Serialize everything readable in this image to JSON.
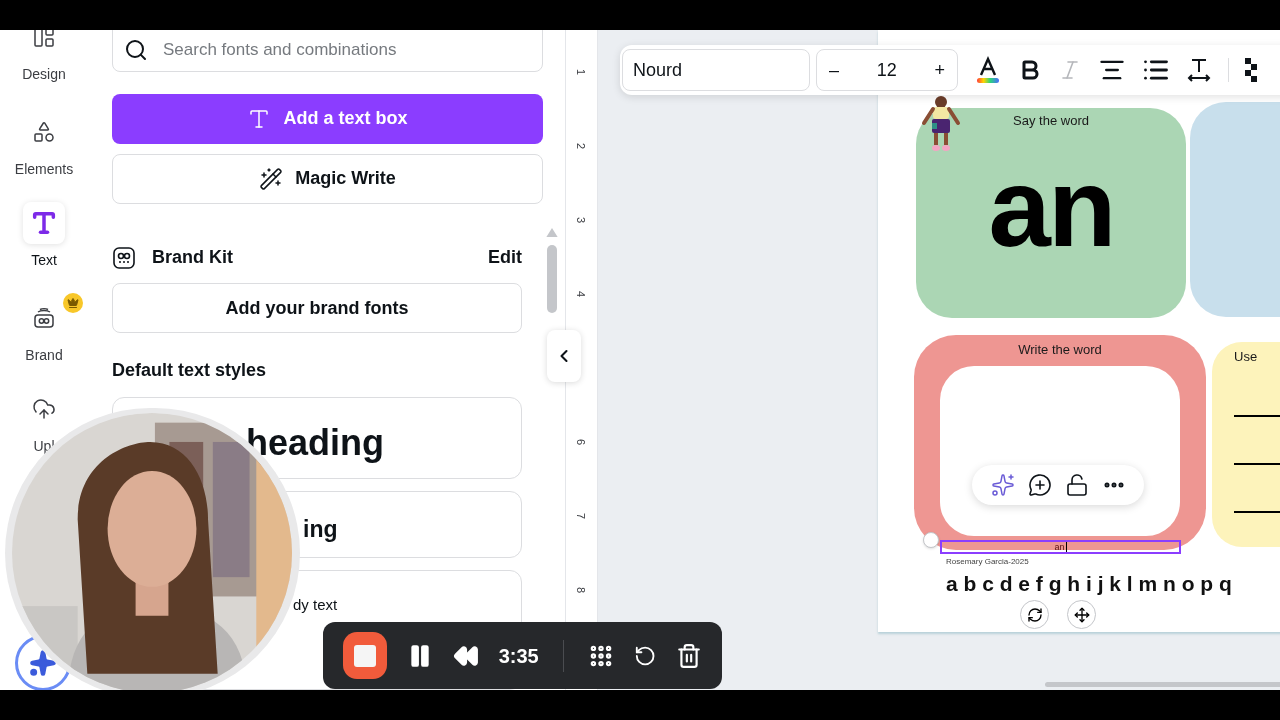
{
  "sidebar": {
    "items": [
      {
        "kind": "design",
        "label": "Design",
        "selected": false,
        "premium": false
      },
      {
        "kind": "elements",
        "label": "Elements",
        "selected": false,
        "premium": false
      },
      {
        "kind": "text",
        "label": "Text",
        "selected": true,
        "premium": false
      },
      {
        "kind": "brand",
        "label": "Brand",
        "selected": false,
        "premium": true
      },
      {
        "kind": "uploads",
        "label": "Upl",
        "selected": false,
        "premium": false
      }
    ]
  },
  "panel": {
    "search": {
      "placeholder": "Search fonts and combinations"
    },
    "add_text_button": "Add a text box",
    "magic_write_button": "Magic Write",
    "brand_kit": {
      "title": "Brand Kit",
      "edit": "Edit",
      "add_fonts_button": "Add your brand fonts"
    },
    "default_styles": {
      "title": "Default text styles",
      "items": [
        {
          "kind": "heading",
          "label": "heading"
        },
        {
          "kind": "subheading",
          "label": "ing"
        },
        {
          "kind": "body",
          "label": "dy text"
        }
      ]
    }
  },
  "ruler": {
    "marks": [
      "1",
      "2",
      "3",
      "4",
      "6",
      "7",
      "8"
    ]
  },
  "toolbar": {
    "font": "Nourd",
    "decrease": "–",
    "size": "12",
    "increase": "+",
    "italic_disabled": true
  },
  "page": {
    "cards": [
      {
        "kind": "word",
        "title": "Say the word",
        "word": "an",
        "color": "#abd6b4"
      },
      {
        "kind": "partial",
        "color": "#c8dfec"
      },
      {
        "kind": "frame",
        "title": "Write the word",
        "color": "#ee9692"
      },
      {
        "kind": "lines",
        "title": "Use",
        "color": "#fdf3bb"
      }
    ],
    "selected_text": "an",
    "credit": "Rosemary Garcia-2025",
    "alphabet": "a b c d e f g h i j k l m n o p q"
  },
  "recorder": {
    "time": "3:35"
  }
}
